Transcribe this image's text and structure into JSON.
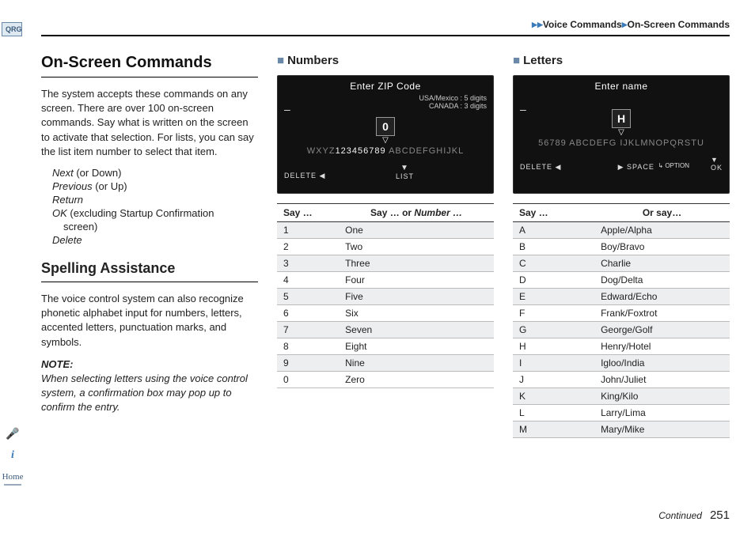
{
  "breadcrumb": {
    "a": "Voice Commands",
    "b": "On-Screen Commands"
  },
  "sidetab": "QRG",
  "homelabel": "Home",
  "col1": {
    "h1": "On-Screen Commands",
    "p1": "The system accepts these commands on any screen. There are over 100 on-screen commands. Say what is written on the screen to activate that selection. For lists, you can say the list item number to select that item.",
    "cmds": {
      "next": "Next",
      "next_note": " (or Down)",
      "prev": "Previous",
      "prev_note": " (or Up)",
      "return": "Return",
      "ok": "OK",
      "ok_note": " (excluding Startup Confirmation",
      "ok_note2": "screen)",
      "delete": "Delete"
    },
    "h2": "Spelling Assistance",
    "p2": "The voice control system can also recognize phonetic alphabet input for numbers, letters, accented letters, punctuation marks, and symbols.",
    "note_label": "NOTE:",
    "note_body": "When selecting letters using the voice control system, a confirmation box may pop up to confirm the entry."
  },
  "numbers": {
    "title": "Numbers",
    "shot": {
      "title": "Enter ZIP Code",
      "sub1": "USA/Mexico : 5 digits",
      "sub2": "CANADA : 3 digits",
      "big": "0",
      "strip_pre": "WXYZ",
      "strip_main": "123456789",
      "strip_gap": "   ",
      "strip_post": "ABCDEFGHIJKL",
      "del": "DELETE",
      "list": "LIST"
    },
    "th1": "Say …",
    "th2": "Say … or",
    "th2i": " Number …",
    "rows": [
      {
        "k": "1",
        "v": "One"
      },
      {
        "k": "2",
        "v": "Two"
      },
      {
        "k": "3",
        "v": "Three"
      },
      {
        "k": "4",
        "v": "Four"
      },
      {
        "k": "5",
        "v": "Five"
      },
      {
        "k": "6",
        "v": "Six"
      },
      {
        "k": "7",
        "v": "Seven"
      },
      {
        "k": "8",
        "v": "Eight"
      },
      {
        "k": "9",
        "v": "Nine"
      },
      {
        "k": "0",
        "v": "Zero"
      }
    ]
  },
  "letters": {
    "title": "Letters",
    "shot": {
      "title": "Enter name",
      "big": "H",
      "strip_pre": "56789   ABCDEFG",
      "strip_post": "IJKLMNOPQRSTU",
      "option": "OPTION",
      "del": "DELETE",
      "space": "SPACE",
      "ok": "OK"
    },
    "th1": "Say …",
    "th2": "Or say…",
    "rows": [
      {
        "k": "A",
        "v": "Apple/Alpha"
      },
      {
        "k": "B",
        "v": "Boy/Bravo"
      },
      {
        "k": "C",
        "v": "Charlie"
      },
      {
        "k": "D",
        "v": "Dog/Delta"
      },
      {
        "k": "E",
        "v": "Edward/Echo"
      },
      {
        "k": "F",
        "v": "Frank/Foxtrot"
      },
      {
        "k": "G",
        "v": "George/Golf"
      },
      {
        "k": "H",
        "v": "Henry/Hotel"
      },
      {
        "k": "I",
        "v": "Igloo/India"
      },
      {
        "k": "J",
        "v": "John/Juliet"
      },
      {
        "k": "K",
        "v": "King/Kilo"
      },
      {
        "k": "L",
        "v": "Larry/Lima"
      },
      {
        "k": "M",
        "v": "Mary/Mike"
      }
    ]
  },
  "footer": {
    "cont": "Continued",
    "page": "251"
  }
}
